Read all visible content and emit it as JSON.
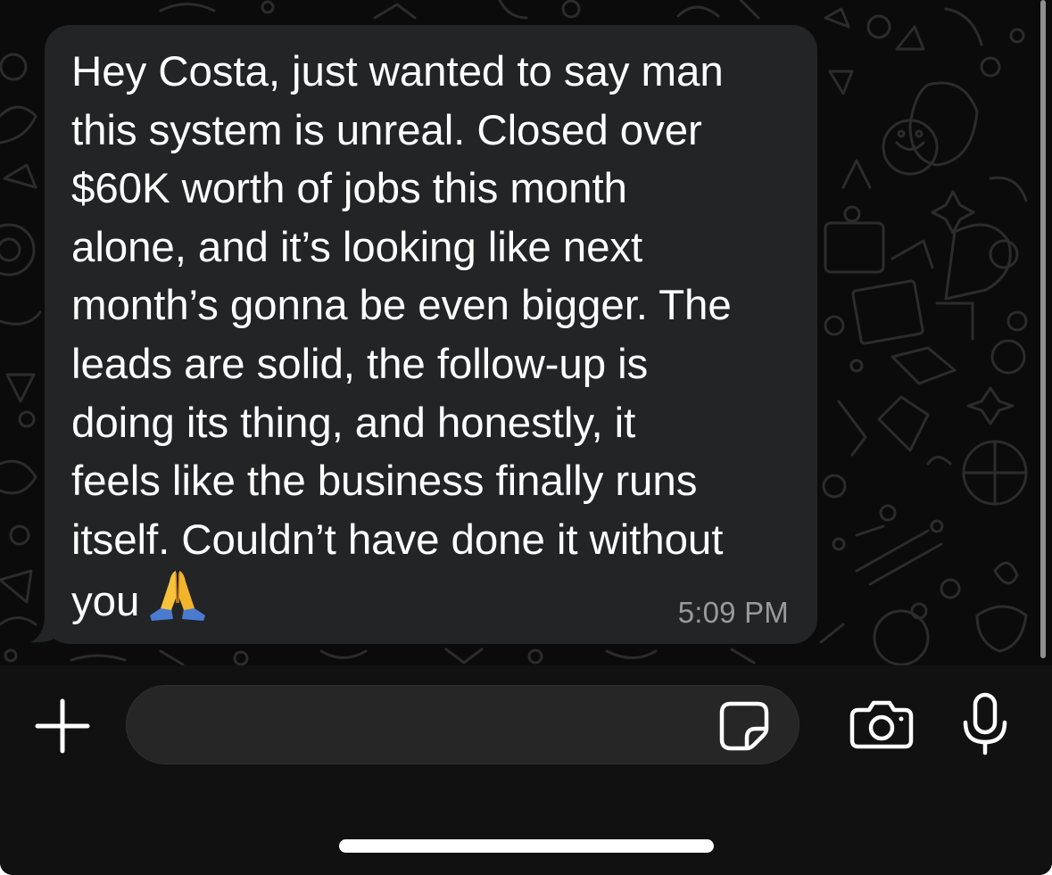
{
  "message": {
    "lines": [
      "Hey Costa, just wanted to say man",
      "this system is unreal. Closed over",
      "$60K worth of jobs this month",
      "alone, and it’s looking like next",
      "month’s gonna be even bigger. The",
      "leads are solid, the follow-up is",
      "doing its thing, and honestly, it",
      "feels like the business finally runs",
      "itself. Couldn’t have done it without",
      "you"
    ],
    "emoji": "folded-hands-emoji",
    "time": "5:09 PM"
  },
  "composer": {
    "input_value": "",
    "icons": [
      "plus-icon",
      "sticker-icon",
      "camera-icon",
      "microphone-icon"
    ]
  },
  "colors": {
    "background": "#0b0b0b",
    "bubble": "#232425",
    "text": "#ffffff",
    "timestamp": "#9a9a9a",
    "input_bar": "#111111",
    "input_field": "#262626"
  }
}
